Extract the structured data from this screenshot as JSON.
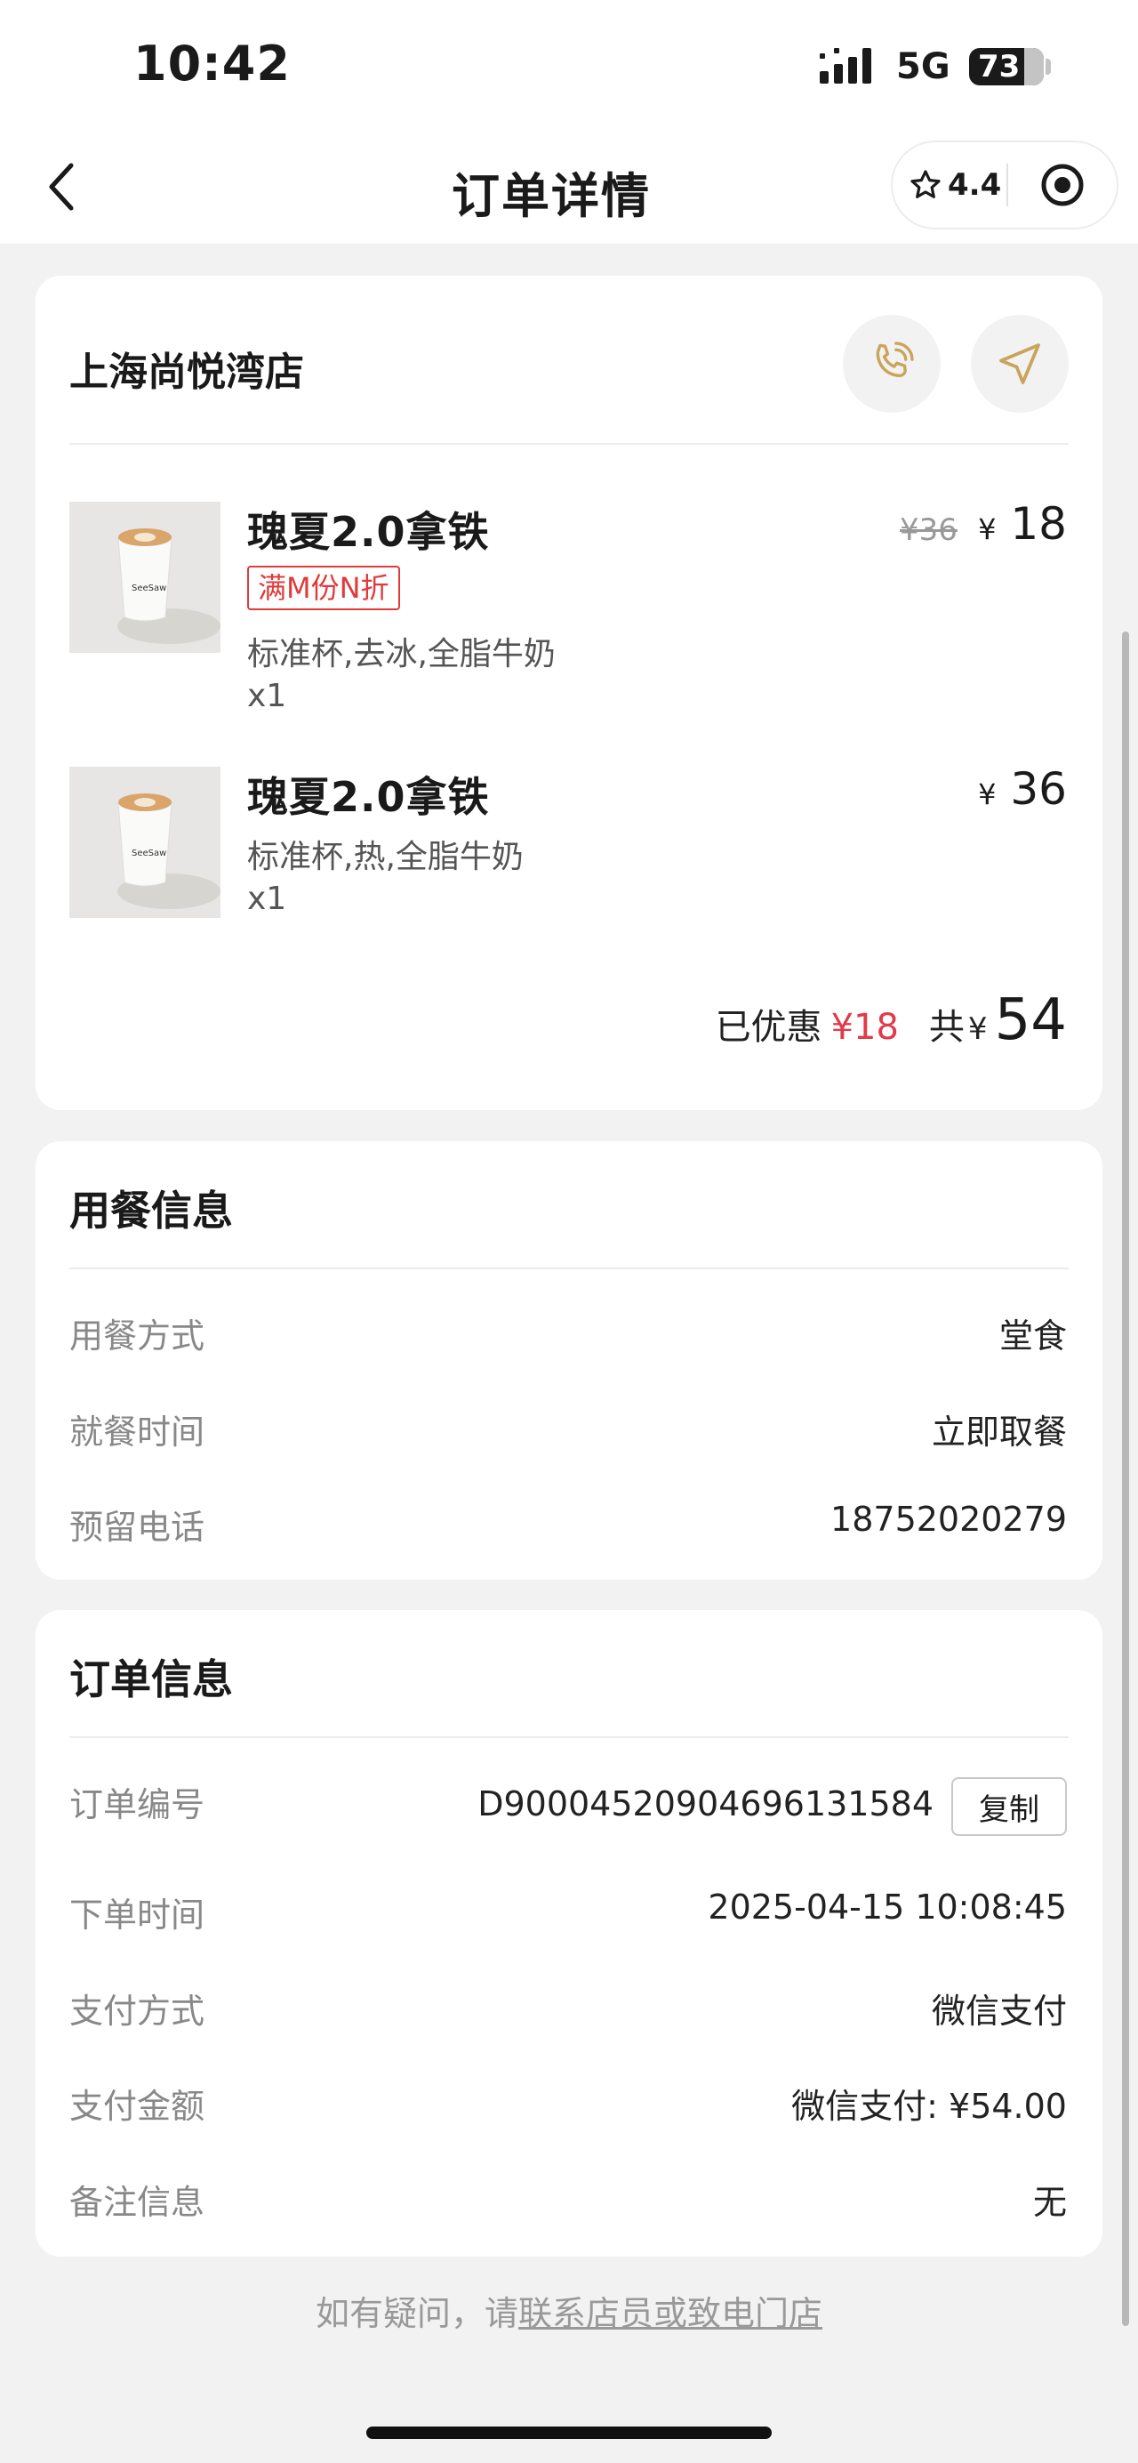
{
  "status": {
    "time": "10:42",
    "network": "5G",
    "battery": "73"
  },
  "nav": {
    "title": "订单详情",
    "rating": "4.4"
  },
  "store": {
    "name": "上海尚悦湾店"
  },
  "items": [
    {
      "name": "瑰夏2.0拿铁",
      "tag": "满M份N折",
      "spec": "标准杯,去冰,全脂牛奶",
      "qty": "x1",
      "old_price": "¥36",
      "currency": "¥",
      "price": "18"
    },
    {
      "name": "瑰夏2.0拿铁",
      "spec": "标准杯,热,全脂牛奶",
      "qty": "x1",
      "currency": "¥",
      "price": "36"
    }
  ],
  "summary": {
    "discount_label": "已优惠",
    "discount": "¥18",
    "total_label": "共",
    "currency": "¥",
    "total": "54"
  },
  "dining": {
    "title": "用餐信息",
    "rows": [
      {
        "label": "用餐方式",
        "value": "堂食"
      },
      {
        "label": "就餐时间",
        "value": "立即取餐"
      },
      {
        "label": "预留电话",
        "value": "18752020279"
      }
    ]
  },
  "order": {
    "title": "订单信息",
    "copy_label": "复制",
    "rows": [
      {
        "label": "订单编号",
        "value": "D900045209046961315​84"
      },
      {
        "label": "下单时间",
        "value": "2025-04-15 10:08:45"
      },
      {
        "label": "支付方式",
        "value": "微信支付"
      },
      {
        "label": "支付金额",
        "value": "微信支付: ¥54.00"
      },
      {
        "label": "备注信息",
        "value": "无"
      }
    ]
  },
  "footer": {
    "prefix": "如有疑问，请",
    "link": "联系店员或致电门店"
  }
}
